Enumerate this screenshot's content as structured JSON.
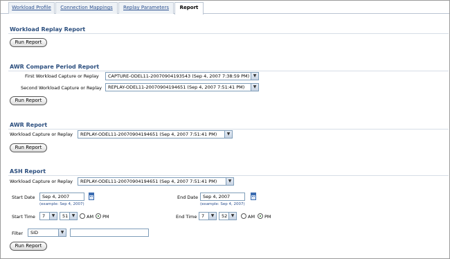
{
  "tabs": [
    {
      "label": "Workload Profile"
    },
    {
      "label": "Connection Mappings"
    },
    {
      "label": "Replay Parameters"
    },
    {
      "label": "Report"
    }
  ],
  "workload_replay": {
    "title": "Workload Replay Report",
    "run_label": "Run Report"
  },
  "awr_compare": {
    "title": "AWR Compare Period Report",
    "first_label": "First Workload Capture or Replay",
    "first_value": "CAPTURE-ODEL11-20070904193543 (Sep 4, 2007 7:38:59 PM)",
    "second_label": "Second Workload Capture or Replay",
    "second_value": "REPLAY-ODEL11-20070904194651 (Sep 4, 2007 7:51:41 PM)",
    "run_label": "Run Report"
  },
  "awr": {
    "title": "AWR Report",
    "capture_label": "Workload Capture or Replay",
    "capture_value": "REPLAY-ODEL11-20070904194651 (Sep 4, 2007 7:51:41 PM)",
    "run_label": "Run Report"
  },
  "ash": {
    "title": "ASH Report",
    "capture_label": "Workload Capture or Replay",
    "capture_value": "REPLAY-ODEL11-20070904194651 (Sep 4, 2007 7:51:41 PM)",
    "start_date_label": "Start Date",
    "start_date_value": "Sep 4, 2007",
    "start_date_hint": "(example: Sep 4, 2007)",
    "end_date_label": "End Date",
    "end_date_value": "Sep 4, 2007",
    "end_date_hint": "(example: Sep 4, 2007)",
    "start_time_label": "Start Time",
    "start_hour": "7",
    "start_minute": "51",
    "end_time_label": "End Time",
    "end_hour": "7",
    "end_minute": "52",
    "am_label": "AM",
    "pm_label": "PM",
    "selected_period": "PM",
    "filter_label": "Filter",
    "filter_select": "SID",
    "filter_value": "",
    "run_label": "Run Report"
  }
}
